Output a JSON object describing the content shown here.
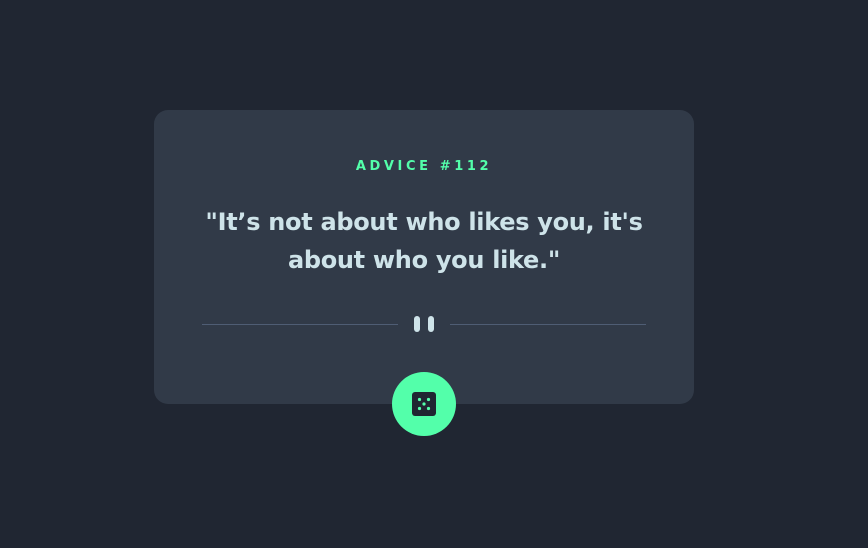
{
  "advice": {
    "id_label": "ADVICE #112",
    "quote": "\"It’s not about who likes you, it's about who you like.\""
  },
  "divider": {
    "icon": "pause-icon"
  },
  "generate_button": {
    "icon": "dice-icon"
  },
  "colors": {
    "background": "#202632",
    "card": "#313a48",
    "accent": "#53ffaa",
    "text": "#cee3e9",
    "divider_line": "#4f5d74"
  }
}
